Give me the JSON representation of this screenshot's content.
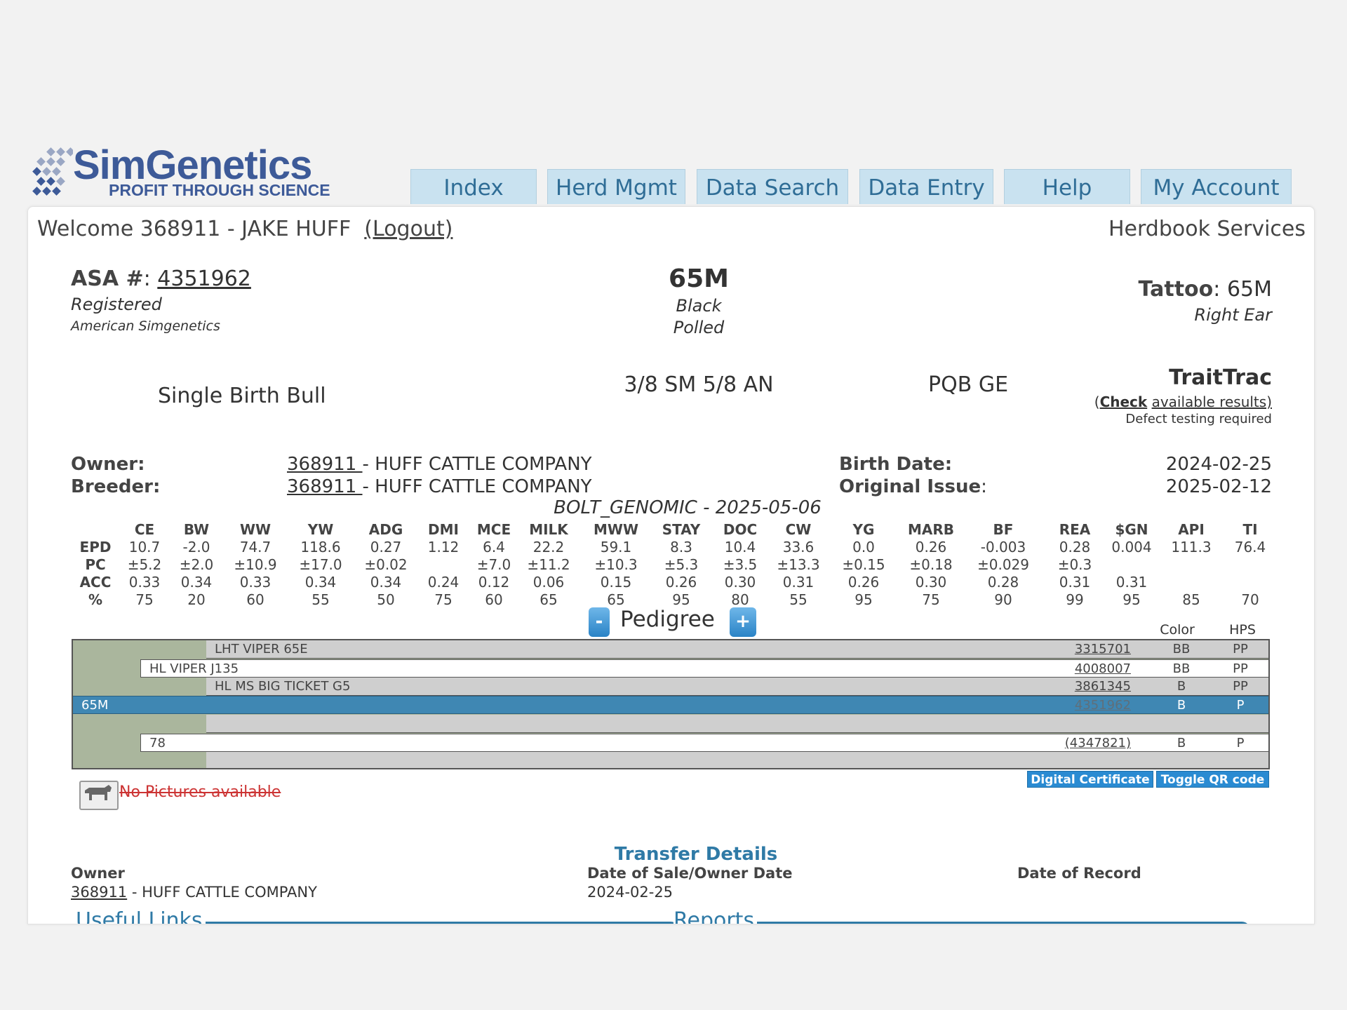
{
  "logo": {
    "title": "SimGenetics",
    "subtitle": "PROFIT THROUGH SCIENCE",
    "icon": "diamond-dots-logo-icon"
  },
  "nav": {
    "tabs": [
      "Index",
      "Herd Mgmt",
      "Data Search",
      "Data Entry",
      "Help",
      "My Account"
    ]
  },
  "header": {
    "welcome": "Welcome 368911 - JAKE HUFF",
    "logout": "(Logout)",
    "service": "Herdbook Services"
  },
  "animal": {
    "asa_label": "ASA #",
    "asa_number": "4351962",
    "status": "Registered",
    "association": "American Simgenetics",
    "name": "65M",
    "color": "Black",
    "horn": "Polled",
    "tattoo_label": "Tattoo",
    "tattoo": "65M",
    "tattoo_location": "Right Ear",
    "birth_type": "Single Birth Bull",
    "breed": "3/8 SM 5/8 AN",
    "genotype": "PQB GE",
    "traittrac_title": "TraitTrac",
    "traittrac_open": "(",
    "traittrac_check": "Check",
    "traittrac_link": "available results)",
    "traittrac_note": "Defect testing required"
  },
  "owner": {
    "owner_label": "Owner:",
    "breeder_label": "Breeder:",
    "owner_id": "368911 ",
    "owner_name": " - HUFF CATTLE COMPANY",
    "breeder_id": "368911 ",
    "breeder_name": " - HUFF CATTLE COMPANY",
    "birth_label": "Birth Date:",
    "birth_date": "2024-02-25",
    "issue_label": "Original Issue",
    "issue_colon": ":",
    "issue_date": "2025-02-12"
  },
  "epd": {
    "run": "BOLT_GENOMIC - 2025-05-06",
    "headers": [
      "",
      "CE",
      "BW",
      "WW",
      "YW",
      "ADG",
      "DMI",
      "MCE",
      "MILK",
      "MWW",
      "STAY",
      "DOC",
      "CW",
      "YG",
      "MARB",
      "BF",
      "REA",
      "$GN",
      "API",
      "TI"
    ],
    "rows": [
      [
        "EPD",
        "10.7",
        "-2.0",
        "74.7",
        "118.6",
        "0.27",
        "1.12",
        "6.4",
        "22.2",
        "59.1",
        "8.3",
        "10.4",
        "33.6",
        "0.0",
        "0.26",
        "-0.003",
        "0.28",
        "0.004",
        "111.3",
        "76.4"
      ],
      [
        "PC",
        "±5.2",
        "±2.0",
        "±10.9",
        "±17.0",
        "±0.02",
        "",
        "±7.0",
        "±11.2",
        "±10.3",
        "±5.3",
        "±3.5",
        "±13.3",
        "±0.15",
        "±0.18",
        "±0.029",
        "±0.3",
        "",
        "",
        ""
      ],
      [
        "ACC",
        "0.33",
        "0.34",
        "0.33",
        "0.34",
        "0.34",
        "0.24",
        "0.12",
        "0.06",
        "0.15",
        "0.26",
        "0.30",
        "0.31",
        "0.26",
        "0.30",
        "0.28",
        "0.31",
        "0.31",
        "",
        ""
      ],
      [
        "%",
        "75",
        "20",
        "60",
        "55",
        "50",
        "75",
        "60",
        "65",
        "65",
        "95",
        "80",
        "55",
        "95",
        "75",
        "90",
        "99",
        "95",
        "85",
        "70"
      ]
    ]
  },
  "pedigree": {
    "title": "Pedigree",
    "minus": "-",
    "plus": "+",
    "color_header": "Color",
    "hps_header": "HPS",
    "rows": [
      {
        "name": "LHT VIPER 65E",
        "reg": "3315701",
        "color": "BB",
        "hps": "PP"
      },
      {
        "name": "HL VIPER J135",
        "reg": "4008007",
        "color": "BB",
        "hps": "PP"
      },
      {
        "name": "HL MS BIG TICKET G5",
        "reg": "3861345",
        "color": "B",
        "hps": "PP"
      },
      {
        "name": "65M",
        "reg": "4351962",
        "color": "B",
        "hps": "P"
      },
      {
        "name": "",
        "reg": "",
        "color": "",
        "hps": ""
      },
      {
        "name": "78",
        "reg": "(4347821)",
        "color": "B",
        "hps": "P"
      },
      {
        "name": "",
        "reg": "",
        "color": "",
        "hps": ""
      }
    ],
    "digital_certificate": "Digital Certificate",
    "toggle_qr": "Toggle QR code"
  },
  "pictures": {
    "text": "No Pictures available",
    "icon": "cow-icon"
  },
  "transfer": {
    "title": "Transfer Details",
    "owner_header": "Owner",
    "date_header": "Date of Sale/Owner Date",
    "record_header": "Date of Record",
    "owner_id": "368911",
    "owner_name": " - HUFF CATTLE COMPANY",
    "date": "2024-02-25"
  },
  "sections": {
    "useful_links": "Useful Links",
    "reports": "Reports"
  },
  "colors": {
    "brand": "#3d5a98",
    "tab_bg": "#c9e2f0",
    "accent": "#2f7aa6",
    "selected_row": "#3f87b3",
    "warning": "#cc3333"
  }
}
